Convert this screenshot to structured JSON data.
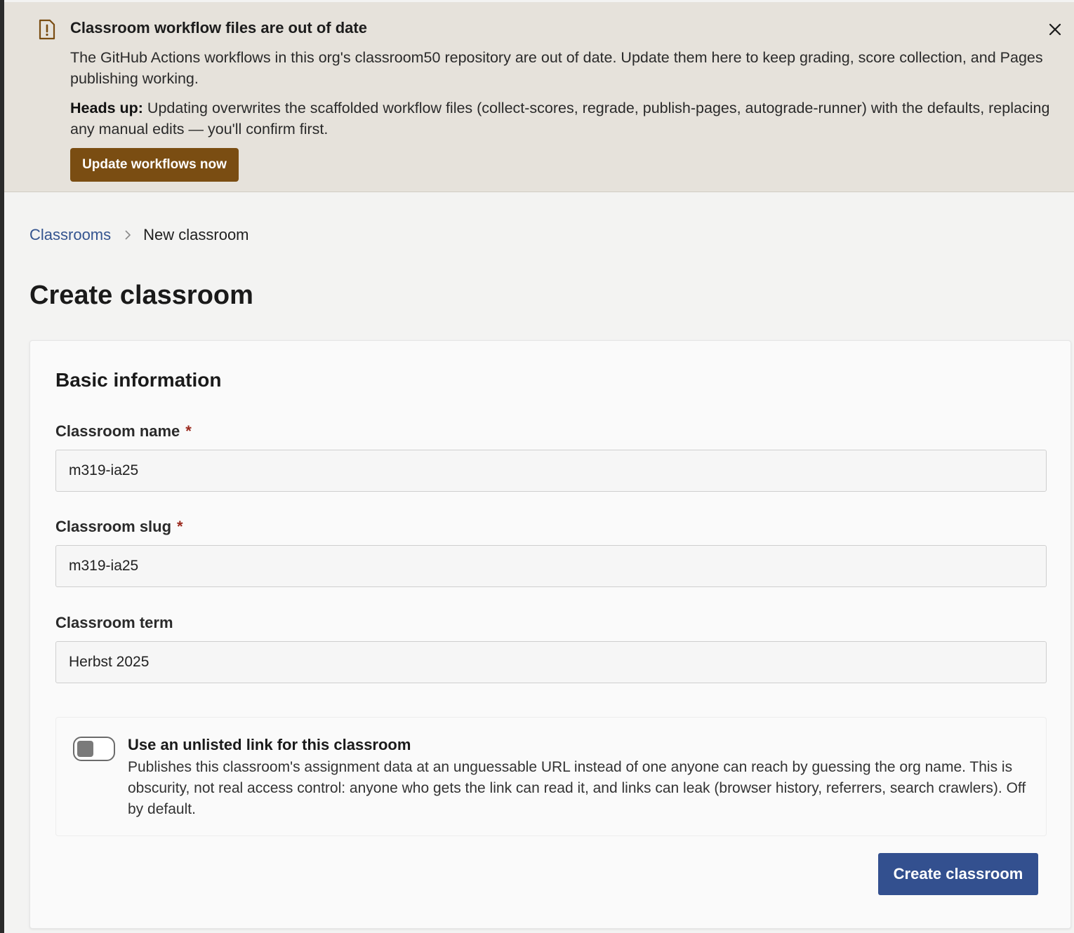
{
  "banner": {
    "title": "Classroom workflow files are out of date",
    "description": "The GitHub Actions workflows in this org's classroom50 repository are out of date. Update them here to keep grading, score collection, and Pages publishing working.",
    "headsup_label": "Heads up:",
    "headsup_text": " Updating overwrites the scaffolded workflow files (collect-scores, regrade, publish-pages, autograde-runner) with the defaults, replacing any manual edits — you'll confirm first.",
    "update_button": "Update workflows now",
    "icon": "file-alert-icon",
    "close_icon": "close-icon"
  },
  "breadcrumb": {
    "parent": "Classrooms",
    "current": "New classroom"
  },
  "page": {
    "title": "Create classroom"
  },
  "form": {
    "section_title": "Basic information",
    "required_marker": "*",
    "name": {
      "label": "Classroom name",
      "value": "m319-ia25"
    },
    "slug": {
      "label": "Classroom slug",
      "value": "m319-ia25"
    },
    "term": {
      "label": "Classroom term",
      "value": "Herbst 2025"
    },
    "unlisted": {
      "title": "Use an unlisted link for this classroom",
      "description": "Publishes this classroom's assignment data at an unguessable URL instead of one anyone can reach by guessing the org name. This is obscurity, not real access control: anyone who gets the link can read it, and links can leak (browser history, referrers, search crawlers). Off by default.",
      "enabled": false
    },
    "submit_button": "Create classroom"
  },
  "colors": {
    "banner_bg": "#e6e2db",
    "warning_brown": "#7a4d12",
    "primary_blue": "#33508f",
    "link_blue": "#34548f",
    "required_red": "#9b2a1e"
  }
}
